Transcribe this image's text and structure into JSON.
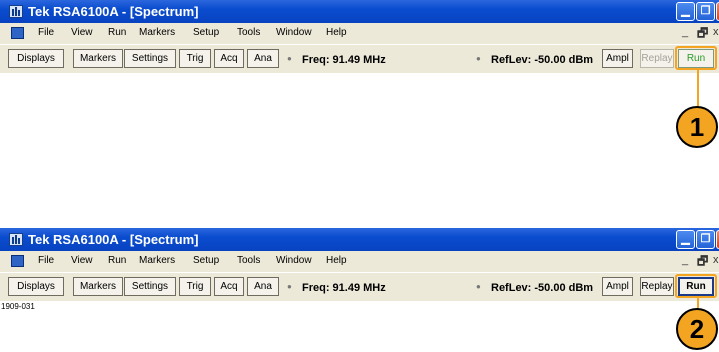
{
  "colors": {
    "titlebar": "#0a4ccf",
    "callout": "#f3a521",
    "run_green": "#2a9b2a",
    "chrome": "#ece9d8"
  },
  "window1": {
    "title": "Tek RSA6100A - [Spectrum]",
    "menu": [
      "File",
      "View",
      "Run",
      "Markers",
      "Setup",
      "Tools",
      "Window",
      "Help"
    ],
    "mdi": {
      "min": "_",
      "restore": "🗗",
      "close": "x"
    },
    "toolbar": {
      "displays": "Displays",
      "markers": "Markers",
      "settings": "Settings",
      "trig": "Trig",
      "acq": "Acq",
      "ana": "Ana",
      "freq": "Freq: 91.49 MHz",
      "reflev": "RefLev: -50.00 dBm",
      "ampl": "Ampl",
      "replay": "Replay",
      "run": "Run"
    },
    "run_state": "green"
  },
  "window2": {
    "title": "Tek RSA6100A - [Spectrum]",
    "menu": [
      "File",
      "View",
      "Run",
      "Markers",
      "Setup",
      "Tools",
      "Window",
      "Help"
    ],
    "mdi": {
      "min": "_",
      "restore": "🗗",
      "close": "x"
    },
    "toolbar": {
      "displays": "Displays",
      "markers": "Markers",
      "settings": "Settings",
      "trig": "Trig",
      "acq": "Acq",
      "ana": "Ana",
      "freq": "Freq: 91.49 MHz",
      "reflev": "RefLev: -50.00 dBm",
      "ampl": "Ampl",
      "replay": "Replay",
      "run": "Run"
    },
    "run_state": "normal"
  },
  "callouts": [
    "1",
    "2"
  ],
  "figure_number": "1909-031"
}
